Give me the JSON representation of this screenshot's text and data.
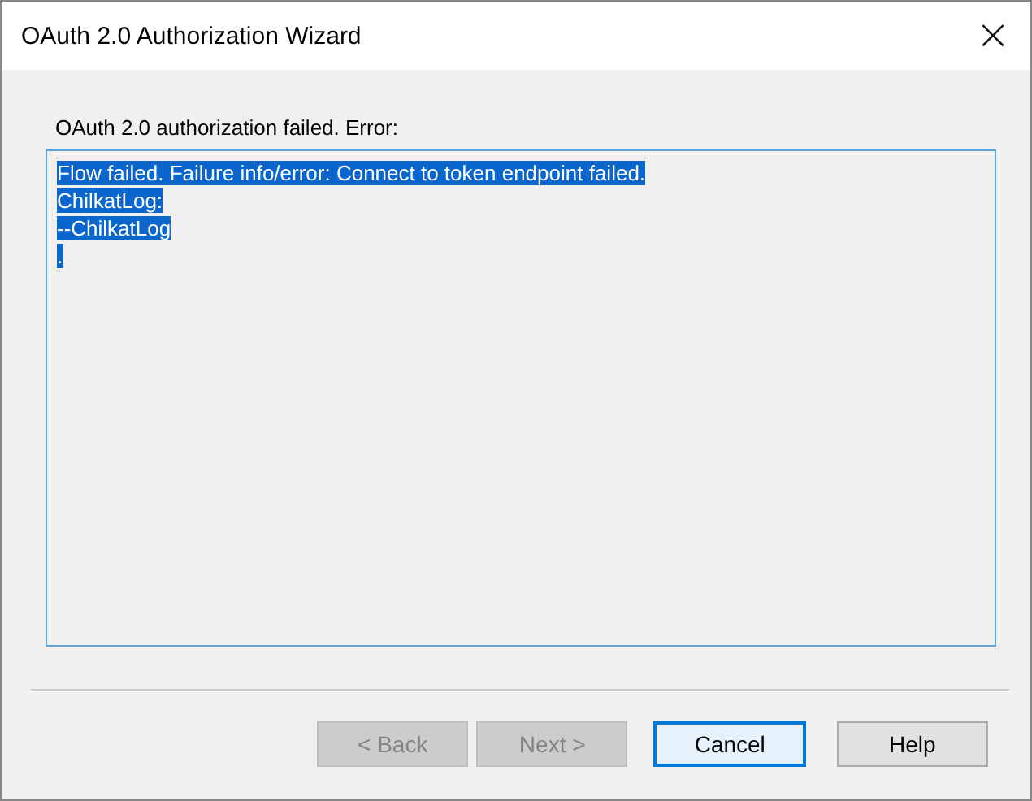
{
  "window": {
    "title": "OAuth 2.0 Authorization Wizard",
    "close": "×"
  },
  "message": "OAuth 2.0 authorization failed. Error:",
  "log": {
    "selected": true,
    "lines": [
      "Flow failed. Failure info/error: Connect to token endpoint failed.",
      "ChilkatLog:",
      "--ChilkatLog",
      "."
    ]
  },
  "buttons": [
    {
      "label": "< Back",
      "disabled": true,
      "focused": false
    },
    {
      "label": "Next >",
      "disabled": true,
      "focused": false
    },
    {
      "label": "Cancel",
      "disabled": false,
      "focused": true
    },
    {
      "label": "Help",
      "disabled": false,
      "focused": false
    }
  ]
}
